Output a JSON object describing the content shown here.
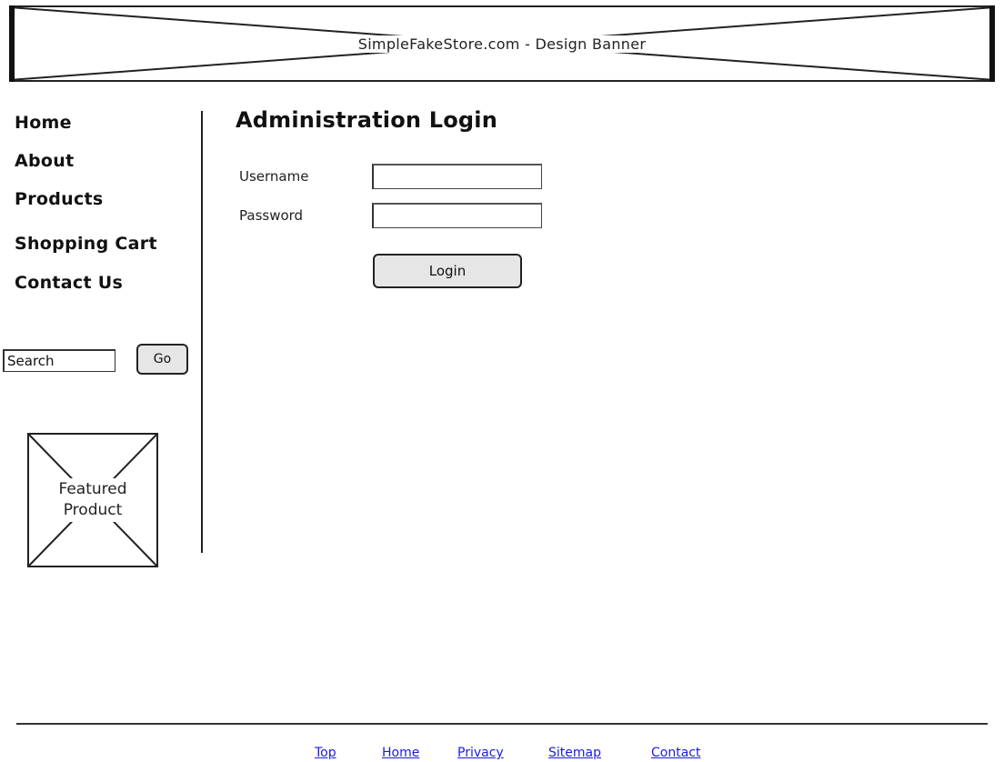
{
  "banner": {
    "text": "SimpleFakeStore.com  -  Design Banner"
  },
  "sidebar": {
    "nav": [
      {
        "label": "Home"
      },
      {
        "label": "About"
      },
      {
        "label": "Products"
      },
      {
        "label": "Shopping Cart"
      },
      {
        "label": "Contact Us"
      }
    ],
    "search": {
      "value": "Search",
      "go_label": "Go"
    },
    "featured_label": "Featured\nProduct"
  },
  "main": {
    "title": "Administration Login",
    "username_label": "Username",
    "password_label": "Password",
    "login_label": "Login"
  },
  "footer": {
    "links": [
      {
        "label": "Top"
      },
      {
        "label": "Home"
      },
      {
        "label": "Privacy"
      },
      {
        "label": "Sitemap"
      },
      {
        "label": "Contact"
      }
    ]
  },
  "colors": {
    "link": "#1a1aee",
    "button_fill": "#e6e6e6",
    "ink": "#222222"
  }
}
